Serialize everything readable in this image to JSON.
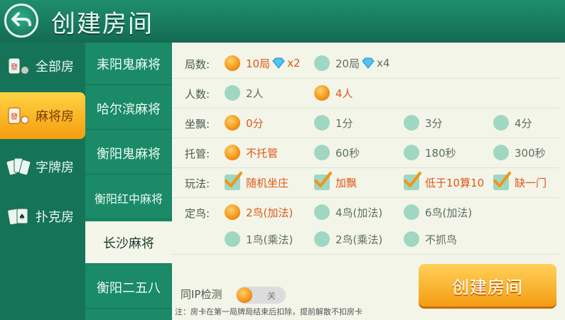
{
  "header": {
    "title": "创建房间"
  },
  "categories": [
    {
      "label": "全部房",
      "icon": "mahjong-tile-icon"
    },
    {
      "label": "麻将房",
      "icon": "mahjong-tile-icon"
    },
    {
      "label": "字牌房",
      "icon": "word-cards-icon"
    },
    {
      "label": "扑克房",
      "icon": "poker-cards-icon"
    }
  ],
  "selected_category": "麻将房",
  "games": [
    "耒阳鬼麻将",
    "哈尔滨麻将",
    "衡阳鬼麻将",
    "衡阳红中麻将",
    "长沙麻将",
    "衡阳二五八"
  ],
  "selected_game": "长沙麻将",
  "options": {
    "rounds": {
      "label": "局数:",
      "items": [
        {
          "text": "10局",
          "suffix": "x2",
          "selected": true
        },
        {
          "text": "20局",
          "suffix": "x4",
          "selected": false
        }
      ]
    },
    "players": {
      "label": "人数:",
      "items": [
        {
          "text": "2人",
          "selected": false
        },
        {
          "text": "4人",
          "selected": true
        }
      ]
    },
    "zuopiao": {
      "label": "坐飘:",
      "items": [
        {
          "text": "0分",
          "selected": true
        },
        {
          "text": "1分",
          "selected": false
        },
        {
          "text": "3分",
          "selected": false
        },
        {
          "text": "4分",
          "selected": false
        }
      ]
    },
    "tuoguan": {
      "label": "托管:",
      "items": [
        {
          "text": "不托管",
          "selected": true
        },
        {
          "text": "60秒",
          "selected": false
        },
        {
          "text": "180秒",
          "selected": false
        },
        {
          "text": "300秒",
          "selected": false
        }
      ]
    },
    "wanfa": {
      "label": "玩法:",
      "items": [
        {
          "text": "随机坐庄",
          "checked": true
        },
        {
          "text": "加飘",
          "checked": true
        },
        {
          "text": "低于10算10",
          "checked": true
        },
        {
          "text": "缺一门",
          "checked": true
        }
      ]
    },
    "dingniao": {
      "label": "定鸟:",
      "items": [
        {
          "text": "2鸟(加法)",
          "selected": true
        },
        {
          "text": "4鸟(加法)",
          "selected": false
        },
        {
          "text": "6鸟(加法)",
          "selected": false
        },
        {
          "text": "1鸟(乘法)",
          "selected": false
        },
        {
          "text": "2鸟(乘法)",
          "selected": false
        },
        {
          "text": "不抓鸟",
          "selected": false
        }
      ]
    }
  },
  "ip_check": {
    "label": "同IP检测",
    "state": "关"
  },
  "create_button": "创建房间",
  "note": "注：房卡在第一局牌局结束后扣除，提前解散不扣房卡",
  "colors": {
    "accent": "#f59c12",
    "selected_text": "#e05617",
    "header": "#1f8e6c"
  }
}
